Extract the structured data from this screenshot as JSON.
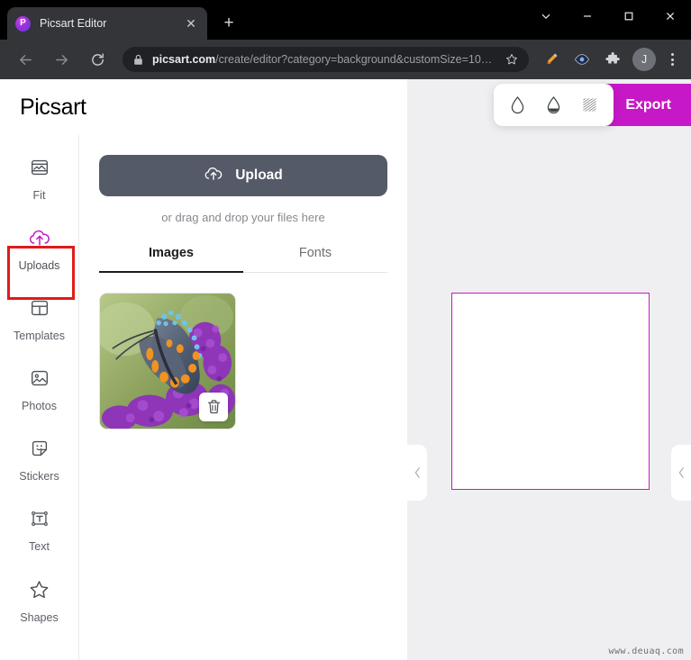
{
  "browser": {
    "tab": {
      "title": "Picsart Editor",
      "favicon": "picsart-logo-icon",
      "close_icon": "close-icon"
    },
    "new_tab_icon": "plus-icon",
    "window_controls": [
      {
        "name": "tab-search-button",
        "icon": "chevron-down-icon"
      },
      {
        "name": "minimize-button",
        "icon": "minimize-icon"
      },
      {
        "name": "maximize-button",
        "icon": "maximize-icon"
      },
      {
        "name": "close-window-button",
        "icon": "close-icon"
      }
    ],
    "nav": {
      "back_icon": "arrow-left-icon",
      "forward_icon": "arrow-right-icon",
      "reload_icon": "reload-icon"
    },
    "omnibox": {
      "lock_icon": "lock-icon",
      "host": "picsart.com",
      "path": "/create/editor?category=background&customSize=10…",
      "bookmark_icon": "star-icon"
    },
    "toolbar_icons": [
      {
        "name": "pencil-highlight-icon",
        "label": "pencil-icon"
      },
      {
        "name": "eye-icon",
        "label": "eye-icon"
      },
      {
        "name": "extensions-icon",
        "label": "puzzle-icon"
      }
    ],
    "profile": {
      "initial": "J"
    },
    "menu_icon": "three-dots-icon"
  },
  "app": {
    "logo": "Picsart",
    "top_toolbar": {
      "fx_icons": [
        {
          "name": "opacity-droplet-icon",
          "label": "droplet-outline-icon"
        },
        {
          "name": "fill-droplet-icon",
          "label": "droplet-half-filled-icon"
        },
        {
          "name": "texture-pattern-icon",
          "label": "diagonal-hatch-icon"
        }
      ],
      "redo_icon": "redo-arrow-icon",
      "export_label": "Export",
      "export_color": "#c618c6"
    },
    "sidebar": {
      "items": [
        {
          "label": "Fit",
          "icon": "fit-image-icon",
          "active": false
        },
        {
          "label": "Uploads",
          "icon": "cloud-upload-icon",
          "active": true
        },
        {
          "label": "Templates",
          "icon": "templates-grid-icon",
          "active": false
        },
        {
          "label": "Photos",
          "icon": "photo-icon",
          "active": false
        },
        {
          "label": "Stickers",
          "icon": "sticker-icon",
          "active": false
        },
        {
          "label": "Text",
          "icon": "text-box-icon",
          "active": false
        },
        {
          "label": "Shapes",
          "icon": "star-shape-icon",
          "active": false
        }
      ],
      "highlight_color": "#e01b1b",
      "active_color": "#c618c6"
    },
    "uploads_panel": {
      "upload_button": {
        "label": "Upload",
        "icon": "cloud-upload-icon"
      },
      "drag_hint": "or drag and drop your files here",
      "tabs": [
        {
          "label": "Images",
          "active": true
        },
        {
          "label": "Fonts",
          "active": false
        }
      ],
      "thumbnails": [
        {
          "name": "butterfly-on-purple-flowers",
          "delete_icon": "trash-icon"
        }
      ]
    },
    "workspace": {
      "canvas_border_color": "#c618c6",
      "collapse_left_icon": "chevron-left-icon",
      "collapse_right_icon": "chevron-left-icon"
    }
  },
  "watermark": "www.deuaq.com"
}
